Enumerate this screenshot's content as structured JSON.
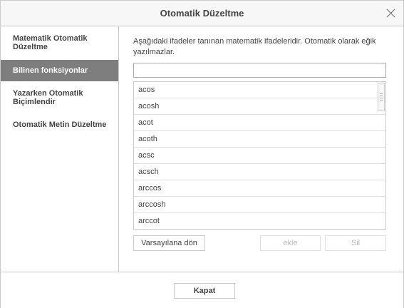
{
  "dialog": {
    "title": "Otomatik Düzeltme"
  },
  "sidebar": {
    "items": [
      {
        "label": "Matematik Otomatik Düzeltme",
        "selected": false
      },
      {
        "label": "Bilinen fonksiyonlar",
        "selected": true
      },
      {
        "label": "Yazarken Otomatik Biçimlendir",
        "selected": false
      },
      {
        "label": "Otomatik Metin Düzeltme",
        "selected": false
      }
    ]
  },
  "main": {
    "description": "Aşağıdaki ifadeler tanınan matematik ifadeleridir. Otomatik olarak eğik yazılmazlar.",
    "search": {
      "value": "",
      "placeholder": ""
    },
    "functions": [
      "acos",
      "acosh",
      "acot",
      "acoth",
      "acsc",
      "acsch",
      "arccos",
      "arccosh",
      "arccot"
    ],
    "buttons": {
      "reset": "Varsayılana dön",
      "add": "ekle",
      "delete": "Sil"
    }
  },
  "footer": {
    "close": "Kapat"
  },
  "icons": {
    "close": "close-icon"
  },
  "colors": {
    "selected_bg": "#7e7e7e",
    "border": "#cbcbcb",
    "text": "#444444"
  }
}
